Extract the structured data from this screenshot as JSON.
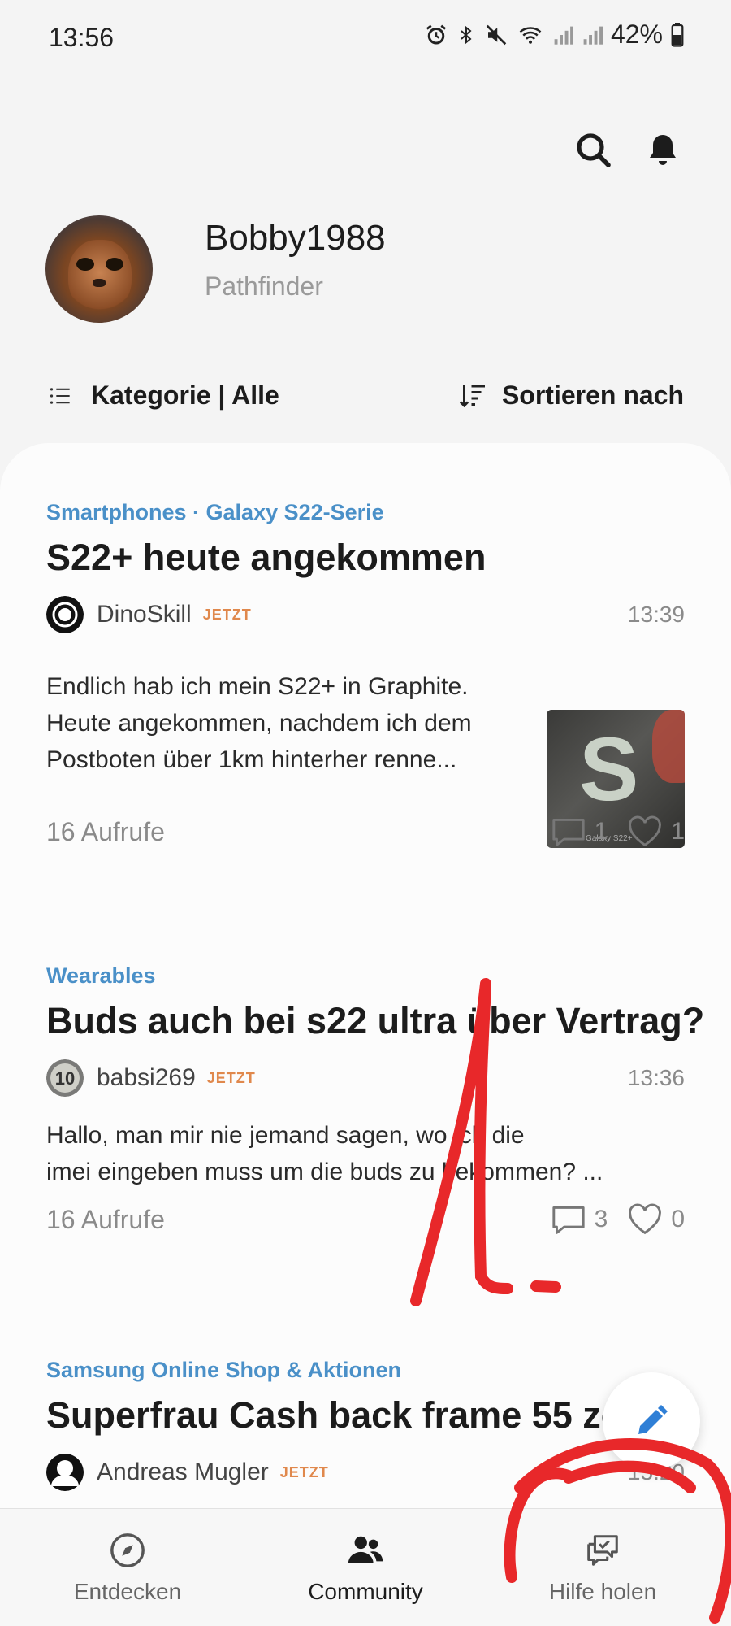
{
  "status_bar": {
    "time": "13:56",
    "battery": "42%"
  },
  "top_actions": {
    "search_icon": "search-icon",
    "bell_icon": "bell-icon"
  },
  "profile": {
    "username": "Bobby1988",
    "rank": "Pathfinder"
  },
  "filter": {
    "category_label": "Kategorie | Alle",
    "sort_label": "Sortieren nach"
  },
  "posts": [
    {
      "category": "Smartphones · Galaxy S22-Serie",
      "title": "S22+ heute angekommen",
      "author": "DinoSkill",
      "badge": "JETZT",
      "time": "13:39",
      "excerpt_lines": [
        "Endlich hab ich mein S22+ in Graphite.",
        "Heute angekommen, nachdem ich dem",
        "Postboten über 1km hinterher renne..."
      ],
      "views": "16 Aufrufe",
      "comments": "1",
      "likes": "1",
      "thumb_label": "Galaxy S22+"
    },
    {
      "category": "Wearables",
      "title": "Buds auch bei s22 ultra über Vertrag?",
      "author": "babsi269",
      "badge": "JETZT",
      "time": "13:36",
      "excerpt_lines": [
        "Hallo, man mir nie jemand sagen, wo ich die",
        "imei eingeben muss um die buds zu bekommen? ..."
      ],
      "views": "16 Aufrufe",
      "comments": "3",
      "likes": "0"
    },
    {
      "category": "Samsung Online Shop & Aktionen",
      "title": "Superfrau Cash back frame 55 zoll",
      "author": "Andreas Mugler",
      "badge": "JETZT",
      "time": "13:20"
    }
  ],
  "bottom_nav": [
    {
      "label": "Entdecken",
      "icon": "compass-icon"
    },
    {
      "label": "Community",
      "icon": "people-icon"
    },
    {
      "label": "Hilfe holen",
      "icon": "chat-help-icon"
    }
  ],
  "annotation": {
    "text": "1.",
    "color": "#e8282a"
  }
}
